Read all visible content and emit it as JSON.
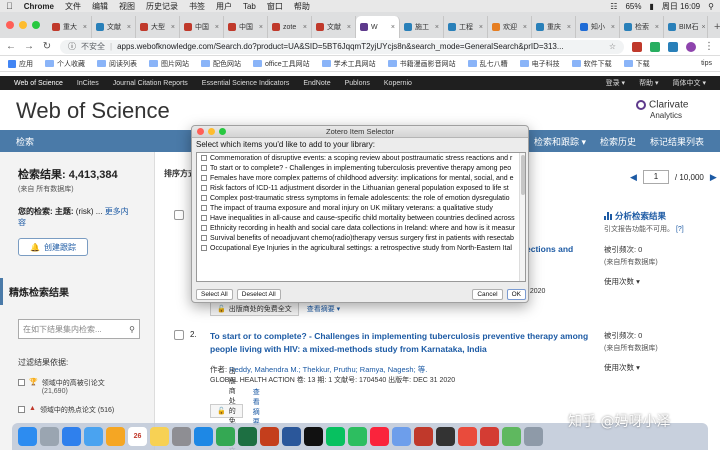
{
  "menubar": {
    "apple": "",
    "app": "Chrome",
    "items": [
      "文件",
      "编辑",
      "视图",
      "历史记录",
      "书签",
      "用户",
      "Tab",
      "窗口",
      "帮助"
    ],
    "battery": "65%",
    "time": "周日 16:09"
  },
  "tabs": [
    {
      "label": "重大",
      "color": "#c0392b"
    },
    {
      "label": "文献",
      "color": "#2980b9"
    },
    {
      "label": "大型",
      "color": "#c0392b"
    },
    {
      "label": "中国",
      "color": "#c0392b"
    },
    {
      "label": "中国",
      "color": "#c0392b"
    },
    {
      "label": "zote",
      "color": "#c0392b"
    },
    {
      "label": "文献",
      "color": "#c0392b"
    },
    {
      "label": "W",
      "color": "#5e3a8c",
      "active": true
    },
    {
      "label": "施工",
      "color": "#2980b9"
    },
    {
      "label": "工程",
      "color": "#2980b9"
    },
    {
      "label": "欢迎",
      "color": "#e67e22"
    },
    {
      "label": "重庆",
      "color": "#2980b9"
    },
    {
      "label": "知小",
      "color": "#1e6bd6"
    },
    {
      "label": "检索",
      "color": "#2980b9"
    },
    {
      "label": "BIM石",
      "color": "#2980b9"
    }
  ],
  "address": {
    "insecure": "不安全",
    "url": "apps.webofknowledge.com/Search.do?product=UA&SID=5BT6JqqmT2yjUYcjs8n&search_mode=GeneralSearch&prID=313..."
  },
  "bookmarks": {
    "items": [
      "应用",
      "个人收藏",
      "阅读列表",
      "图片网站",
      "配色网站",
      "office工具网站",
      "学术工具网站",
      "书籍漫画影音网站",
      "乱七八糟",
      "电子科技",
      "软件下载",
      "下载"
    ],
    "right": "tips"
  },
  "wosnav": {
    "items": [
      "Web of Science",
      "InCites",
      "Journal Citation Reports",
      "Essential Science Indicators",
      "EndNote",
      "Publons",
      "Kopernio"
    ],
    "right": [
      "登录 ▾",
      "帮助 ▾",
      "简体中文 ▾"
    ]
  },
  "header": {
    "title": "Web of Science",
    "brand": "Clarivate",
    "brand_sub": "Analytics"
  },
  "bluebar": {
    "left": "检索",
    "right": [
      "检索和跟踪 ▾",
      "检索历史",
      "标记结果列表"
    ]
  },
  "left": {
    "count_label": "检索结果: 4,413,384",
    "count_sub": "(来自 所有数据库)",
    "your_search_label": "您的检索: 主题:",
    "your_search_value": " (risk) ...",
    "more": "更多内容",
    "alert_button": "创建跟踪",
    "refine_heading": "精炼检索结果",
    "refine_placeholder": "在如下结果集内检索...",
    "filter_heading": "过滤结果依据:",
    "filters": [
      {
        "label": "领域中的高被引论文",
        "count": "(21,690)"
      },
      {
        "label": "领域中的热点论文",
        "count": "(516)"
      }
    ]
  },
  "main": {
    "sort_label": "排序方式",
    "partial_title": "ections and",
    "partial_date": "0 2020",
    "free_button": "出版商处的免费全文",
    "abstract_link": "查看摘要 ▾",
    "result2": {
      "num": "2.",
      "title": "To start or to complete? - Challenges in implementing tuberculosis preventive therapy among people living with HIV: a mixed-methods study from Karnataka, India",
      "authors_prefix": "作者: ",
      "authors": "Reddy, Mahendra M.; Thekkur, Pruthu; Ramya, Nagesh; 等.",
      "journal": "GLOBAL HEALTH ACTION  卷: 13  期: 1  文献号: 1704540  出版年: DEC 31 2020"
    }
  },
  "right": {
    "page_value": "1",
    "page_total": "/ 10,000",
    "analyze": "分析检索结果",
    "cite_note": "引文报告功能不可用。",
    "cite_help": "[?]",
    "cited_label": "被引频次: 0",
    "cited_sub": "(来自所有数据库)",
    "usage_label": "使用次数 ▾"
  },
  "dialog": {
    "title": "Zotero Item Selector",
    "prompt": "Select which items you'd like to add to your library:",
    "items": [
      "Commemoration of disruptive events: a scoping review about posttraumatic stress reactions and r",
      "To start or to complete? - Challenges in implementing tuberculosis preventive therapy among peo",
      "Females have more complex patterns of childhood adversity: implications for mental, social, and e",
      "Risk factors of ICD-11 adjustment disorder in the Lithuanian general population exposed to life st",
      "Complex post-traumatic stress symptoms in female adolescents: the role of emotion dysregulatio",
      "The impact of trauma exposure and moral injury on UK military veterans: a qualitative study",
      "Have inequalities in all-cause and cause-specific child mortality between countries declined across",
      "Ethnicity recording in health and social care data collections in Ireland: where and how is it measur",
      "Survival benefits of neoadjuvant chemo(radio)therapy versus surgery first in patients with resectab",
      "Occupational Eye Injuries in the agricultural settings: a retrospective study from North-Eastern Ital"
    ],
    "select_all": "Select All",
    "deselect_all": "Deselect All",
    "cancel": "Cancel",
    "ok": "OK"
  },
  "dock": {
    "icons": [
      "finder-icon",
      "launchpad-icon",
      "safari-icon",
      "mail-icon",
      "photos-icon",
      "calendar-icon",
      "notes-icon",
      "settings-icon",
      "app-store-icon",
      "chrome-icon",
      "excel-icon",
      "powerpoint-icon",
      "word-icon",
      "qq-icon",
      "wechat-icon",
      "evernote-icon",
      "music-icon",
      "preview-icon",
      "zotero-icon",
      "terminal-icon",
      "wps-icon",
      "netease-icon",
      "maps-icon",
      "trash-icon"
    ],
    "calendar_day": "26"
  },
  "watermark": "知乎 @妈呀小泽"
}
